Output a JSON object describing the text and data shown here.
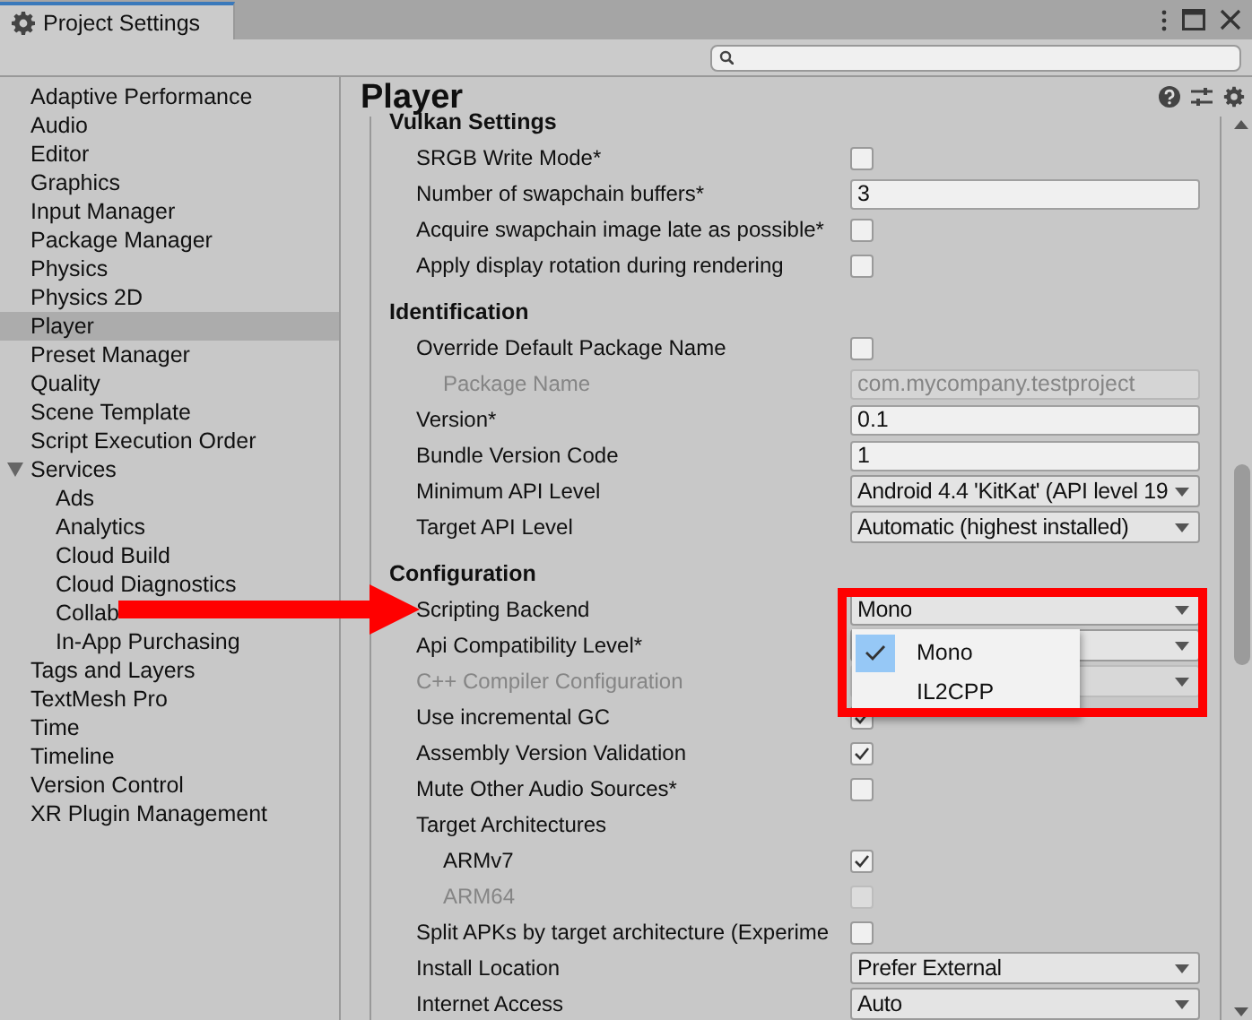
{
  "window": {
    "title": "Project Settings"
  },
  "sidebar": {
    "items": [
      {
        "label": "Adaptive Performance",
        "selected": false
      },
      {
        "label": "Audio",
        "selected": false
      },
      {
        "label": "Editor",
        "selected": false
      },
      {
        "label": "Graphics",
        "selected": false
      },
      {
        "label": "Input Manager",
        "selected": false
      },
      {
        "label": "Package Manager",
        "selected": false
      },
      {
        "label": "Physics",
        "selected": false
      },
      {
        "label": "Physics 2D",
        "selected": false
      },
      {
        "label": "Player",
        "selected": true
      },
      {
        "label": "Preset Manager",
        "selected": false
      },
      {
        "label": "Quality",
        "selected": false
      },
      {
        "label": "Scene Template",
        "selected": false
      },
      {
        "label": "Script Execution Order",
        "selected": false
      },
      {
        "label": "Services",
        "selected": false,
        "expanded": true,
        "children": [
          {
            "label": "Ads",
            "selected": false
          },
          {
            "label": "Analytics",
            "selected": false
          },
          {
            "label": "Cloud Build",
            "selected": false
          },
          {
            "label": "Cloud Diagnostics",
            "selected": false
          },
          {
            "label": "Collab",
            "selected": false
          },
          {
            "label": "In-App Purchasing",
            "selected": false
          }
        ]
      },
      {
        "label": "Tags and Layers",
        "selected": false
      },
      {
        "label": "TextMesh Pro",
        "selected": false
      },
      {
        "label": "Time",
        "selected": false
      },
      {
        "label": "Timeline",
        "selected": false
      },
      {
        "label": "Version Control",
        "selected": false
      },
      {
        "label": "XR Plugin Management",
        "selected": false
      }
    ]
  },
  "panel": {
    "title": "Player",
    "sections": [
      {
        "title": "Vulkan Settings",
        "rows": [
          {
            "kind": "checkbox",
            "label": "SRGB Write Mode*",
            "checked": false,
            "disabled": false
          },
          {
            "kind": "text",
            "label": "Number of swapchain buffers*",
            "value": "3",
            "disabled": false
          },
          {
            "kind": "checkbox",
            "label": "Acquire swapchain image late as possible*",
            "checked": false,
            "disabled": false
          },
          {
            "kind": "checkbox",
            "label": "Apply display rotation during rendering",
            "checked": false,
            "disabled": false
          }
        ]
      },
      {
        "title": "Identification",
        "rows": [
          {
            "kind": "checkbox",
            "label": "Override Default Package Name",
            "checked": false,
            "disabled": false,
            "children": [
              {
                "kind": "text",
                "label": "Package Name",
                "value": "com.mycompany.testproject",
                "disabled": true
              }
            ]
          },
          {
            "kind": "text",
            "label": "Version*",
            "value": "0.1",
            "disabled": false
          },
          {
            "kind": "text",
            "label": "Bundle Version Code",
            "value": "1",
            "disabled": false
          },
          {
            "kind": "dropdown",
            "label": "Minimum API Level",
            "value": "Android 4.4 'KitKat' (API level 19",
            "disabled": false
          },
          {
            "kind": "dropdown",
            "label": "Target API Level",
            "value": "Automatic (highest installed)",
            "disabled": false
          }
        ]
      },
      {
        "title": "Configuration",
        "rows": [
          {
            "kind": "dropdown",
            "label": "Scripting Backend",
            "value": "Mono",
            "disabled": false,
            "highlighted": true,
            "arrow": true,
            "open": true,
            "menu": [
              {
                "label": "Mono",
                "selected": true
              },
              {
                "label": "IL2CPP",
                "selected": false
              }
            ]
          },
          {
            "kind": "dropdown",
            "label": "Api Compatibility Level*",
            "disabled": false
          },
          {
            "kind": "dropdown",
            "label": "C++ Compiler Configuration",
            "disabled": true
          },
          {
            "kind": "checkbox",
            "label": "Use incremental GC",
            "checked": true,
            "disabled": false
          },
          {
            "kind": "checkbox",
            "label": "Assembly Version Validation",
            "checked": true,
            "disabled": false
          },
          {
            "kind": "checkbox",
            "label": "Mute Other Audio Sources*",
            "checked": false,
            "disabled": false
          },
          {
            "kind": "group",
            "label": "Target Architectures",
            "disabled": false,
            "children": [
              {
                "kind": "checkbox",
                "label": "ARMv7",
                "checked": true,
                "disabled": false
              },
              {
                "kind": "checkbox",
                "label": "ARM64",
                "checked": false,
                "disabled": true
              }
            ]
          },
          {
            "kind": "checkbox",
            "label": "Split APKs by target architecture (Experime",
            "checked": false,
            "disabled": false
          },
          {
            "kind": "dropdown",
            "label": "Install Location",
            "value": "Prefer External",
            "disabled": false
          },
          {
            "kind": "dropdown",
            "label": "Internet Access",
            "value": "Auto",
            "disabled": false
          }
        ]
      }
    ]
  }
}
